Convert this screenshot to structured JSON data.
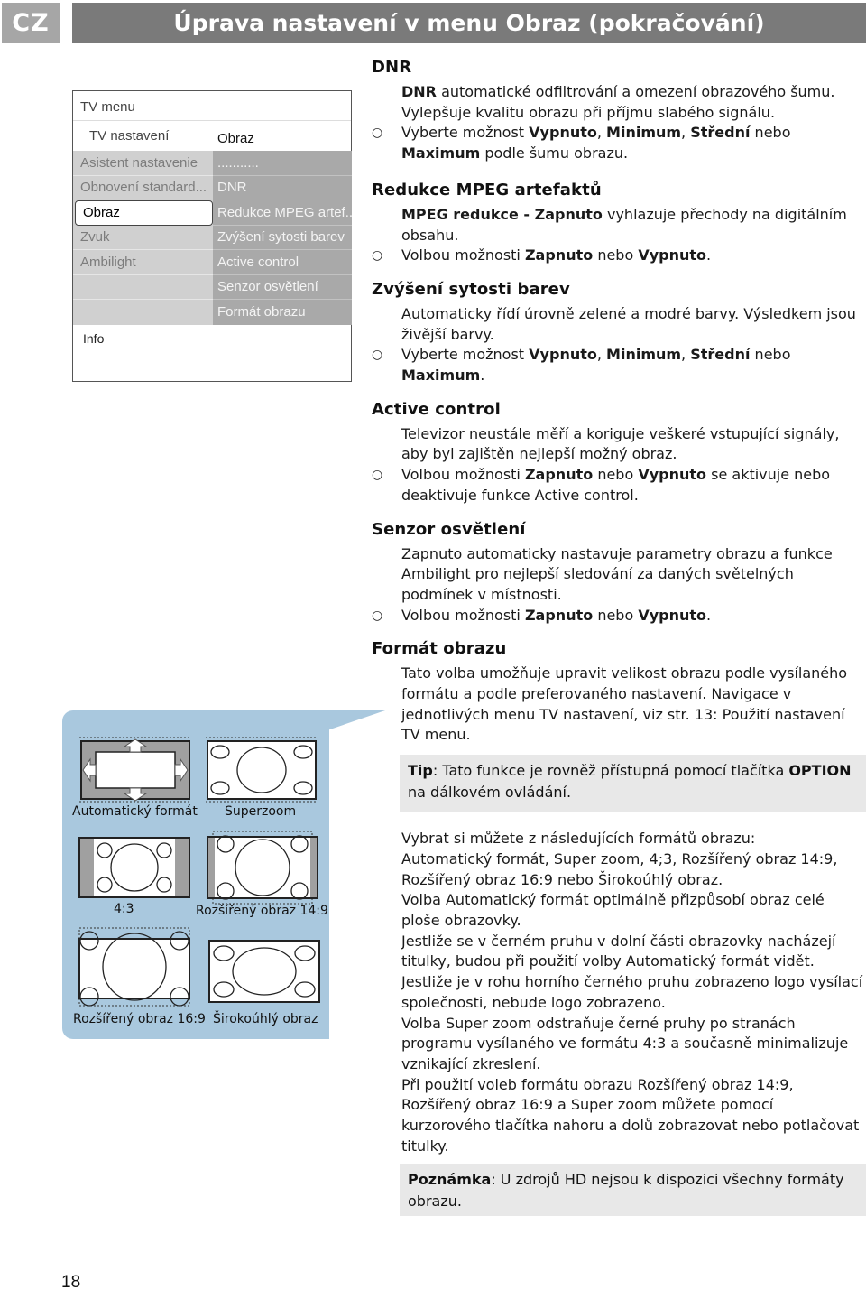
{
  "header": {
    "lang": "CZ",
    "title": "Úprava nastavení v menu Obraz (pokračování)"
  },
  "tv_menu": {
    "title": "TV menu",
    "breadcrumb_left": "TV nastavení",
    "breadcrumb_right": "Obraz",
    "left_items": [
      {
        "label": "Asistent nastavenie",
        "selected": false
      },
      {
        "label": "Obnovení standard...",
        "selected": false
      },
      {
        "label": "Obraz",
        "selected": true
      },
      {
        "label": "Zvuk",
        "selected": false
      },
      {
        "label": "Ambilight",
        "selected": false
      },
      {
        "label": "",
        "selected": false
      },
      {
        "label": "",
        "selected": false
      }
    ],
    "right_items": [
      "...........",
      "DNR",
      "Redukce MPEG artef..",
      "Zvýšení sytosti barev",
      "Active control",
      "Senzor osvětlení",
      "Formát obrazu"
    ],
    "info_label": "Info"
  },
  "sections": {
    "dnr": {
      "heading": "DNR",
      "p1_bold": "DNR",
      "p1_rest": " automatické odfiltrování a omezení obrazového šumu. Vylepšuje kvalitu obrazu při příjmu slabého signálu.",
      "b1_pre": "Vyberte možnost ",
      "b1_o1": "Vypnuto",
      "b1_sep1": ", ",
      "b1_o2": "Minimum",
      "b1_sep2": ", ",
      "b1_o3": "Střední",
      "b1_mid": " nebo ",
      "b1_o4": "Maximum",
      "b1_post": " podle šumu obrazu."
    },
    "mpeg": {
      "heading": "Redukce MPEG artefaktů",
      "p1_bold": "MPEG redukce - Zapnuto",
      "p1_rest": " vyhlazuje přechody na digitálním obsahu.",
      "b1_pre": "Volbou možnosti ",
      "b1_o1": "Zapnuto",
      "b1_mid": " nebo ",
      "b1_o2": "Vypnuto",
      "b1_post": "."
    },
    "saturation": {
      "heading": "Zvýšení sytosti barev",
      "p1": "Automaticky řídí úrovně zelené a modré barvy. Výsledkem jsou živější barvy.",
      "b1_pre": "Vyberte možnost ",
      "b1_o1": "Vypnuto",
      "b1_sep1": ", ",
      "b1_o2": "Minimum",
      "b1_sep2": ", ",
      "b1_o3": "Střední",
      "b1_mid": " nebo ",
      "b1_o4": "Maximum",
      "b1_post": "."
    },
    "active": {
      "heading": "Active control",
      "p1": "Televizor neustále měří a koriguje veškeré vstupující signály, aby byl zajištěn nejlepší možný obraz.",
      "b1_pre": "Volbou možnosti ",
      "b1_o1": "Zapnuto",
      "b1_mid": " nebo ",
      "b1_o2": "Vypnuto",
      "b1_post": " se aktivuje nebo deaktivuje funkce Active control."
    },
    "sensor": {
      "heading": "Senzor osvětlení",
      "p1": "Zapnuto automaticky nastavuje parametry obrazu a funkce Ambilight pro nejlepší sledování za daných světelných podmínek v místnosti.",
      "b1_pre": "Volbou možnosti ",
      "b1_o1": "Zapnuto",
      "b1_mid": " nebo ",
      "b1_o2": "Vypnuto",
      "b1_post": "."
    },
    "format": {
      "heading": "Formát obrazu",
      "p1": "Tato volba umožňuje upravit velikost obrazu podle vysílaného formátu a podle preferovaného nastavení. Navigace v jednotlivých menu TV nastavení, viz str. 13: Použití nastavení TV menu.",
      "tip_bold": "Tip",
      "tip_pre": ": Tato funkce je rovněž přístupná pomocí tlačítka ",
      "tip_key": "OPTION",
      "tip_post": " na dálkovém ovládání.",
      "p2_lines": [
        "Vybrat si můžete z následujících formátů obrazu:",
        "Automatický formát, Super zoom, 4;3, Rozšířený obraz 14:9, Rozšířený obraz 16:9 nebo Širokoúhlý obraz.",
        "Volba Automatický formát optimálně přizpůsobí obraz celé ploše obrazovky.",
        "Jestliže se v černém pruhu v dolní části obrazovky nacházejí titulky, budou při použití volby Automatický formát vidět.",
        "Jestliže je v rohu horního černého pruhu zobrazeno logo vysílací společnosti, nebude logo zobrazeno.",
        "Volba Super zoom odstraňuje černé pruhy po stranách programu vysílaného ve formátu 4:3 a současně minimalizuje vznikající zkreslení.",
        "Při použití voleb formátu obrazu Rozšířený obraz 14:9, Rozšířený obraz 16:9 a Super zoom můžete pomocí kurzorového tlačítka nahoru a dolů zobrazovat nebo potlačovat titulky."
      ],
      "note_bold": "Poznámka",
      "note_rest": ": U zdrojů HD nejsou k dispozici všechny formáty obrazu."
    }
  },
  "illustrations": {
    "items": [
      "Automatický formát",
      "Superzoom",
      "4:3",
      "Rozšířený obraz 14:9",
      "Rozšířený obraz 16:9",
      "Širokoúhlý obraz"
    ],
    "panel_color": "#a9c8de",
    "bar_color": "#a0a0a0"
  },
  "page_number": "18"
}
